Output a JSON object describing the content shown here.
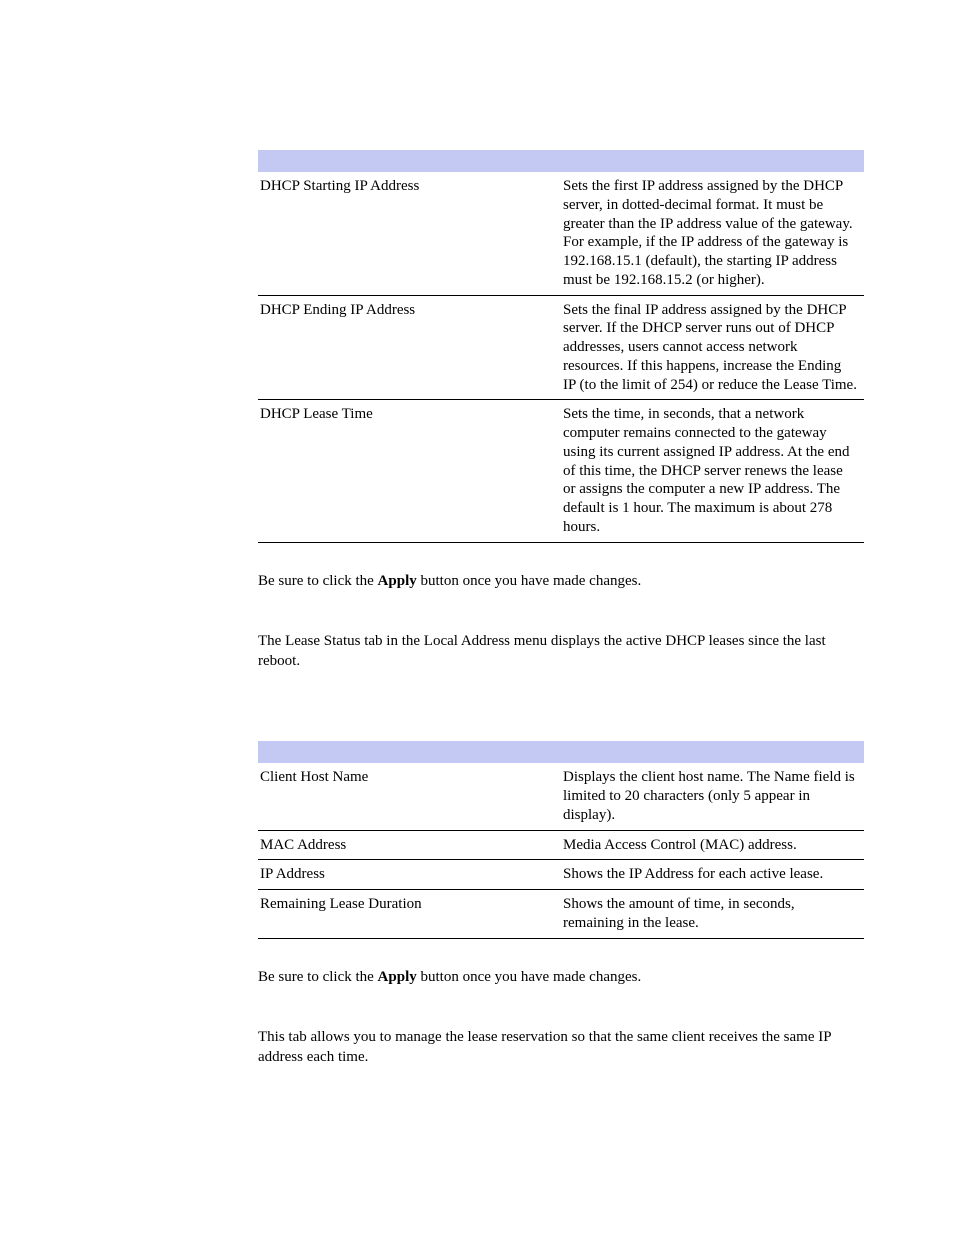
{
  "table1": {
    "rows": [
      {
        "option": "DHCP Starting IP Address",
        "desc": "Sets the first IP address assigned by the DHCP server, in dotted-decimal format. It must be greater than the IP address value of the gateway. For example, if the IP address of the gateway is 192.168.15.1 (default), the starting IP address must be 192.168.15.2 (or higher)."
      },
      {
        "option": "DHCP Ending IP Address",
        "desc": "Sets the final IP address assigned by the DHCP server. If the DHCP server runs out of DHCP addresses, users cannot access network resources. If this happens, increase the Ending IP (to the limit of 254) or reduce the Lease Time."
      },
      {
        "option": "DHCP Lease Time",
        "desc": "Sets the time, in seconds, that a network computer remains connected to the gateway using its current assigned IP address. At the end of this time, the DHCP server renews the lease or assigns the computer a new IP address. The default is 1 hour. The maximum is about 278 hours."
      }
    ]
  },
  "para_apply_prefix": "Be sure to click the ",
  "para_apply_bold": "Apply",
  "para_apply_suffix": " button once you have made changes.",
  "para_lease_status": "The Lease Status tab in the Local Address menu displays the active DHCP leases since the last reboot.",
  "table2": {
    "rows": [
      {
        "option": "Client Host Name",
        "desc": "Displays the client host name. The Name field is limited to 20 characters (only 5 appear in display)."
      },
      {
        "option": "MAC Address",
        "desc": "Media Access Control (MAC) address."
      },
      {
        "option": "IP Address",
        "desc": "Shows the IP Address for each active lease."
      },
      {
        "option": "Remaining Lease Duration",
        "desc": "Shows the amount of time, in seconds, remaining in the lease."
      }
    ]
  },
  "para_lease_reservation": "This tab allows you to manage the lease reservation so that the same client receives the same IP address each time."
}
